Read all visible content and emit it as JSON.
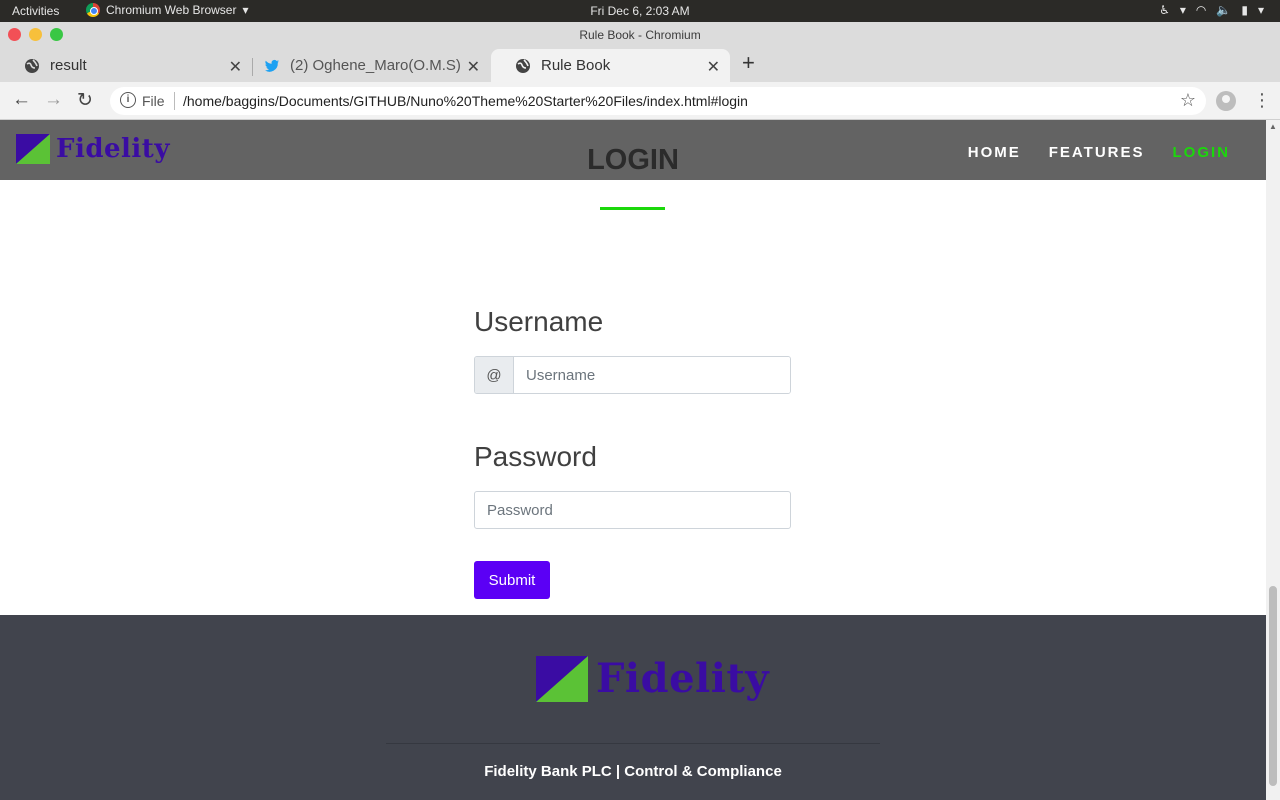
{
  "os_bar": {
    "activities": "Activities",
    "app_menu": "Chromium Web Browser",
    "clock": "Fri Dec  6,  2:03 AM"
  },
  "window": {
    "title": "Rule Book - Chromium"
  },
  "tabs": [
    {
      "label": "result",
      "icon": "globe-icon",
      "active": false
    },
    {
      "label": "(2) Oghene_Maro(O.M.S)",
      "icon": "twitter-icon",
      "active": false
    },
    {
      "label": "Rule Book",
      "icon": "globe-icon",
      "active": true
    }
  ],
  "address_bar": {
    "scheme": "File",
    "url": "/home/baggins/Documents/GITHUB/Nuno%20Theme%20Starter%20Files/index.html#login"
  },
  "site": {
    "brand": "Fidelity",
    "nav": [
      {
        "label": "HOME",
        "active": false
      },
      {
        "label": "FEATURES",
        "active": false
      },
      {
        "label": "LOGIN",
        "active": true
      }
    ],
    "section_title": "LOGIN",
    "accent": "#1bd80b",
    "button_color": "#5b00f5"
  },
  "form": {
    "username_label": "Username",
    "username_addon": "@",
    "username_placeholder": "Username",
    "password_label": "Password",
    "password_placeholder": "Password",
    "submit_label": "Submit"
  },
  "footer": {
    "brand": "Fidelity",
    "text": "Fidelity Bank PLC | Control & Compliance"
  }
}
